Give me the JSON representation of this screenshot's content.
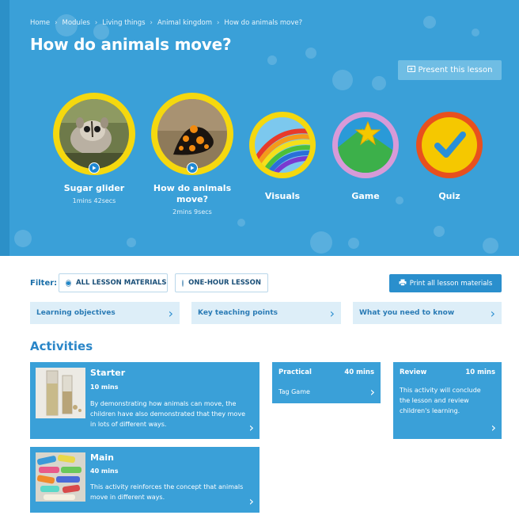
{
  "breadcrumb": [
    "Home",
    "Modules",
    "Living things",
    "Animal kingdom",
    "How do animals move?"
  ],
  "breadcrumb_separator": "›",
  "page_title": "How do animals move?",
  "present_button": "Present this lesson",
  "resources": [
    {
      "title": "Sugar glider",
      "time": "1mins 42secs",
      "icon": "sugar-glider-photo"
    },
    {
      "title": "How do animals move?",
      "time": "2mins 9secs",
      "icon": "salamander-photo"
    },
    {
      "title": "Visuals",
      "icon": "rainbow-icon"
    },
    {
      "title": "Game",
      "icon": "star-mountain-icon"
    },
    {
      "title": "Quiz",
      "icon": "checkmark-icon"
    }
  ],
  "filter": {
    "label": "Filter:",
    "options": [
      "ALL LESSON MATERIALS",
      "ONE-HOUR LESSON"
    ],
    "selected": "ALL LESSON MATERIALS"
  },
  "print_button": "Print all lesson materials",
  "accordions": [
    "Learning objectives",
    "Key teaching points",
    "What you need to know"
  ],
  "activities_heading": "Activities",
  "activities": {
    "starter": {
      "title": "Starter",
      "duration": "10 mins",
      "description": "By demonstrating how animals can move, the children have also demonstrated that they move in lots of different ways."
    },
    "practical": {
      "title": "Practical",
      "duration": "40 mins",
      "item": "Tag Game"
    },
    "review": {
      "title": "Review",
      "duration": "10 mins",
      "description": "This activity will conclude the lesson and review children's learning."
    },
    "main": {
      "title": "Main",
      "duration": "40 mins",
      "description": "This activity reinforces the concept that animals move in different ways."
    }
  },
  "colors": {
    "hero_blue": "#3aa0d8",
    "card_blue": "#3aa0d8",
    "accordion_bg": "#ddeef8",
    "ring_yellow": "#f5d80f",
    "game_purple": "#d89ad8",
    "quiz_red": "#e8501e"
  }
}
